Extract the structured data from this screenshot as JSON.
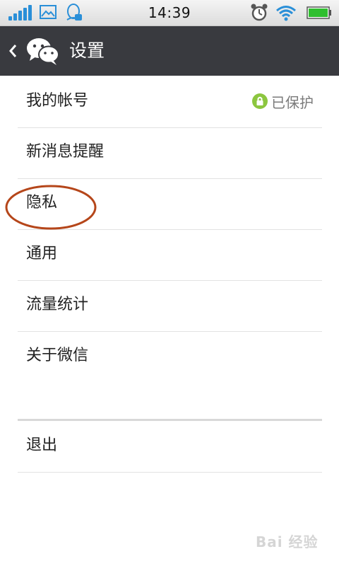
{
  "status_bar": {
    "time": "14:39",
    "icons": [
      "signal-icon",
      "gallery-icon",
      "qq-icon",
      "alarm-icon",
      "wifi-icon",
      "battery-icon"
    ],
    "signal_color": "#2a8fd8",
    "battery_color": "#2fbf2f"
  },
  "header": {
    "title": "设置",
    "background": "#393a3f",
    "back_icon": "chevron-left-icon",
    "logo_icon": "wechat-logo-icon"
  },
  "settings": {
    "items": [
      {
        "label": "我的帐号",
        "extra": "已保护",
        "extra_icon": "lock-icon"
      },
      {
        "label": "新消息提醒"
      },
      {
        "label": "隐私"
      },
      {
        "label": "通用"
      },
      {
        "label": "流量统计"
      },
      {
        "label": "关于微信"
      }
    ],
    "logout": {
      "label": "退出"
    }
  },
  "annotation": {
    "highlight_color": "#b5461a",
    "highlighted_item": "隐私"
  },
  "watermark": {
    "text": "Bai 经验"
  }
}
